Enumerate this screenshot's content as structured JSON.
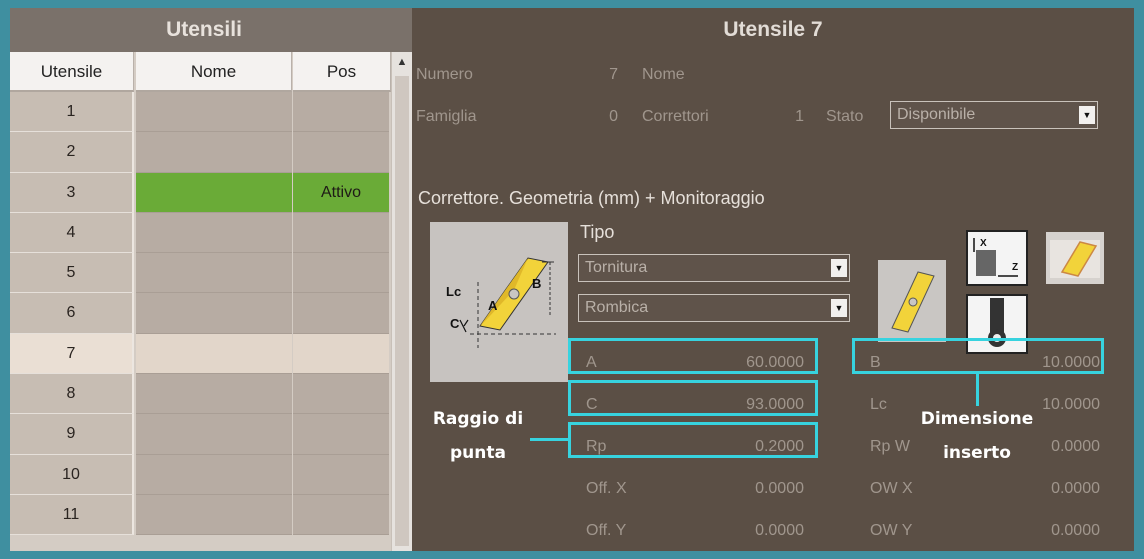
{
  "left_panel": {
    "title": "Utensili",
    "columns": [
      "Utensile",
      "Nome",
      "Pos"
    ],
    "rows": [
      {
        "num": "1",
        "nome": "",
        "pos": ""
      },
      {
        "num": "2",
        "nome": "",
        "pos": ""
      },
      {
        "num": "3",
        "nome": "",
        "pos": "Attivo"
      },
      {
        "num": "4",
        "nome": "",
        "pos": ""
      },
      {
        "num": "5",
        "nome": "",
        "pos": ""
      },
      {
        "num": "6",
        "nome": "",
        "pos": ""
      },
      {
        "num": "7",
        "nome": "",
        "pos": ""
      },
      {
        "num": "8",
        "nome": "",
        "pos": ""
      },
      {
        "num": "9",
        "nome": "",
        "pos": ""
      },
      {
        "num": "10",
        "nome": "",
        "pos": ""
      },
      {
        "num": "11",
        "nome": "",
        "pos": ""
      }
    ],
    "active_row": 3,
    "selected_row": 7,
    "active_color": "#6aab37"
  },
  "right_panel": {
    "title": "Utensile 7",
    "numero_label": "Numero",
    "numero_value": "7",
    "nome_label": "Nome",
    "famiglia_label": "Famiglia",
    "famiglia_value": "0",
    "correttori_label": "Correttori",
    "correttori_value": "1",
    "stato_label": "Stato",
    "stato_value": "Disponibile",
    "section_title": "Correttore. Geometria (mm) + Monitoraggio",
    "tipo_label": "Tipo",
    "tipo_value": "Tornitura",
    "forma_value": "Rombica",
    "diagram_labels": {
      "lc": "Lc",
      "c": "C",
      "a": "A",
      "b": "B"
    },
    "axis_labels": {
      "x": "X",
      "z": "Z"
    },
    "fields_left": [
      {
        "label": "A",
        "value": "60.0000"
      },
      {
        "label": "C",
        "value": "93.0000"
      },
      {
        "label": "Rp",
        "value": "0.2000"
      },
      {
        "label": "Off. X",
        "value": "0.0000"
      },
      {
        "label": "Off. Y",
        "value": "0.0000"
      }
    ],
    "fields_right": [
      {
        "label": "B",
        "value": "10.0000"
      },
      {
        "label": "Lc",
        "value": "10.0000"
      },
      {
        "label": "Rp W",
        "value": "0.0000"
      },
      {
        "label": "OW X",
        "value": "0.0000"
      },
      {
        "label": "OW Y",
        "value": "0.0000"
      }
    ]
  },
  "annotations": {
    "raggio_di_punta": "Raggio di punta",
    "dimensione_inserto": "Dimensione inserto",
    "highlight_color": "#37d3df"
  },
  "icons": [
    "insert-diagram-icon",
    "rhombic-insert-icon",
    "xz-axis-icon",
    "insert-orientation-icon",
    "tool-holder-icon",
    "dropdown-arrow-icon",
    "scroll-up-icon"
  ]
}
